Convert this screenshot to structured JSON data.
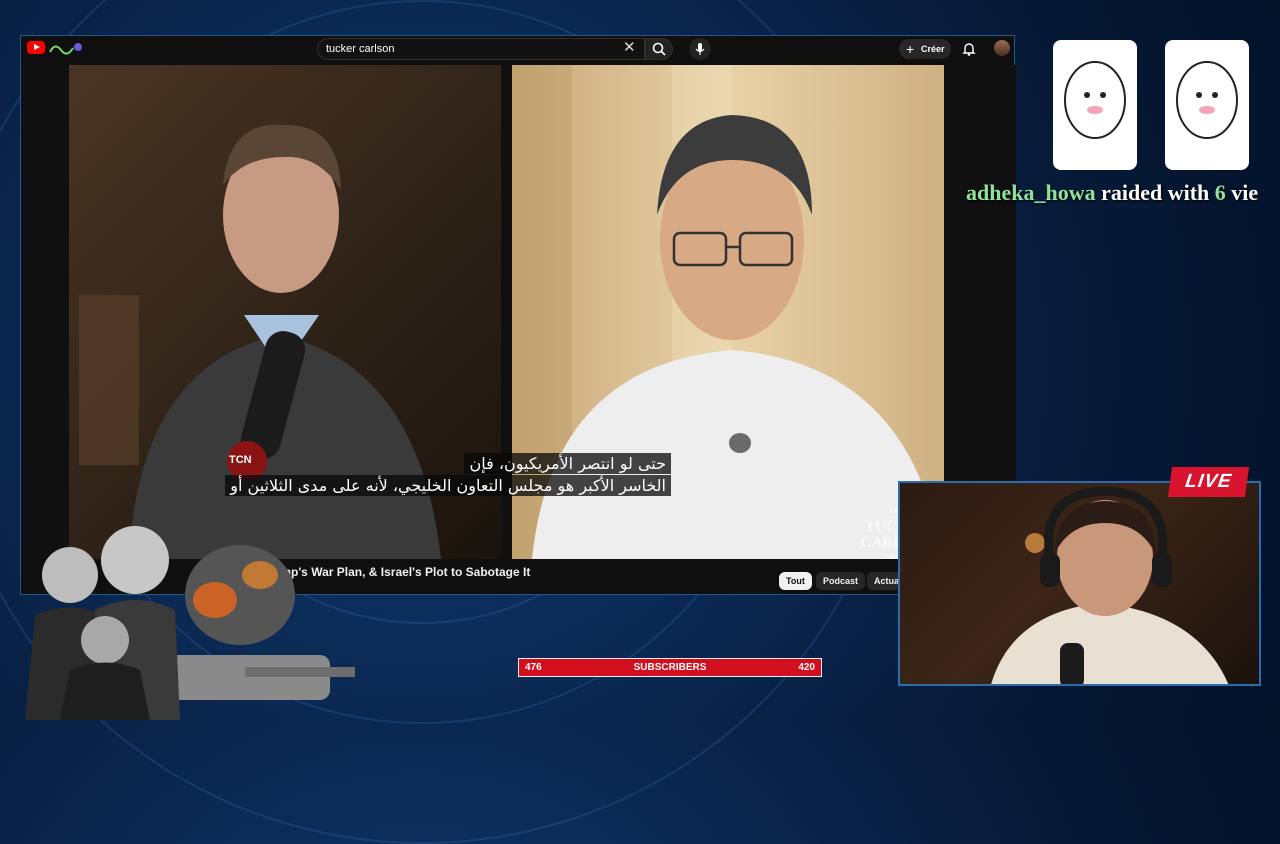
{
  "browser": {
    "search": {
      "value": "tucker carlson"
    },
    "create_label": "Créer"
  },
  "video": {
    "subtitles": [
      "حتى لو انتصر الأمريكيون، فإن",
      "الخاسر الأكبر هو مجلس التعاون الخليجي، لأنه على مدى الثلاثين أو"
    ],
    "watermark": [
      "THE",
      "TUCKER",
      "CARLSON",
      "SHOW"
    ],
    "mic_badge": "TCN",
    "title": "ump's War Plan, & Israel's Plot to Sabotage It"
  },
  "chips": [
    {
      "label": "Tout",
      "active": true
    },
    {
      "label": "Podcast",
      "active": false
    },
    {
      "label": "Actual",
      "active": false
    }
  ],
  "raid": {
    "user": "adheka_howa",
    "middle": "raided with",
    "count": "6",
    "tail": "vie"
  },
  "live_badge": "LIVE",
  "subscribers": {
    "left": "476",
    "label": "SUBSCRIBERS",
    "right": "420"
  },
  "colors": {
    "accent_red": "#d20f1f",
    "live_red": "#d8142e",
    "frame_blue": "#2a6bb0",
    "raid_green": "#8fe39a"
  }
}
